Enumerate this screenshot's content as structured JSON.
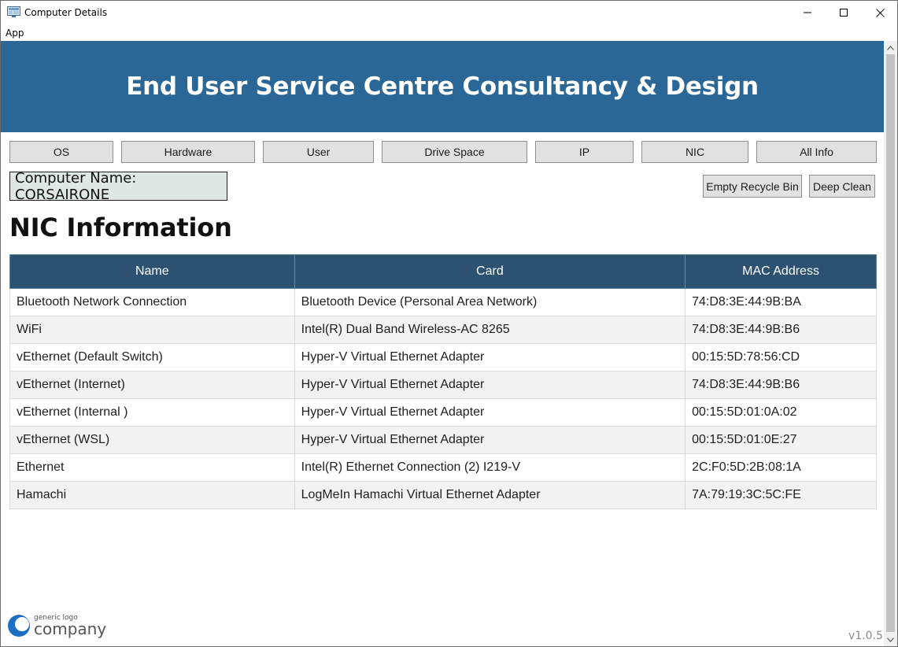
{
  "window": {
    "title": "Computer Details",
    "controls": {
      "minimize": "minimize",
      "maximize": "maximize",
      "close": "close"
    }
  },
  "menu": {
    "items": [
      "App"
    ]
  },
  "banner": {
    "title": "End User Service Centre Consultancy & Design",
    "color": "#2a6797"
  },
  "nav": {
    "buttons": [
      "OS",
      "Hardware",
      "User",
      "Drive Space",
      "IP",
      "NIC",
      "All Info"
    ]
  },
  "computer": {
    "name_label": "Computer Name: CORSAIRONE"
  },
  "actions": {
    "empty_recycle_bin": "Empty Recycle Bin",
    "deep_clean": "Deep Clean"
  },
  "section": {
    "title": "NIC Information"
  },
  "table": {
    "headers": [
      "Name",
      "Card",
      "MAC Address"
    ],
    "header_color": "#2c5171",
    "rows": [
      [
        "Bluetooth Network Connection",
        "Bluetooth Device (Personal Area Network)",
        "74:D8:3E:44:9B:BA"
      ],
      [
        "WiFi",
        "Intel(R) Dual Band Wireless-AC 8265",
        "74:D8:3E:44:9B:B6"
      ],
      [
        "vEthernet (Default Switch)",
        "Hyper-V Virtual Ethernet Adapter",
        "00:15:5D:78:56:CD"
      ],
      [
        "vEthernet (Internet)",
        "Hyper-V Virtual Ethernet Adapter",
        "74:D8:3E:44:9B:B6"
      ],
      [
        "vEthernet (Internal )",
        "Hyper-V Virtual Ethernet Adapter",
        "00:15:5D:01:0A:02"
      ],
      [
        "vEthernet (WSL)",
        "Hyper-V Virtual Ethernet Adapter",
        "00:15:5D:01:0E:27"
      ],
      [
        "Ethernet",
        "Intel(R) Ethernet Connection (2) I219-V",
        "2C:F0:5D:2B:08:1A"
      ],
      [
        "Hamachi",
        "LogMeIn Hamachi Virtual Ethernet Adapter",
        "7A:79:19:3C:5C:FE"
      ]
    ]
  },
  "logo": {
    "small_text": "generic logo",
    "big_text": "company",
    "icon": "logo-circle-icon"
  },
  "footer": {
    "version": "v1.0.5"
  }
}
